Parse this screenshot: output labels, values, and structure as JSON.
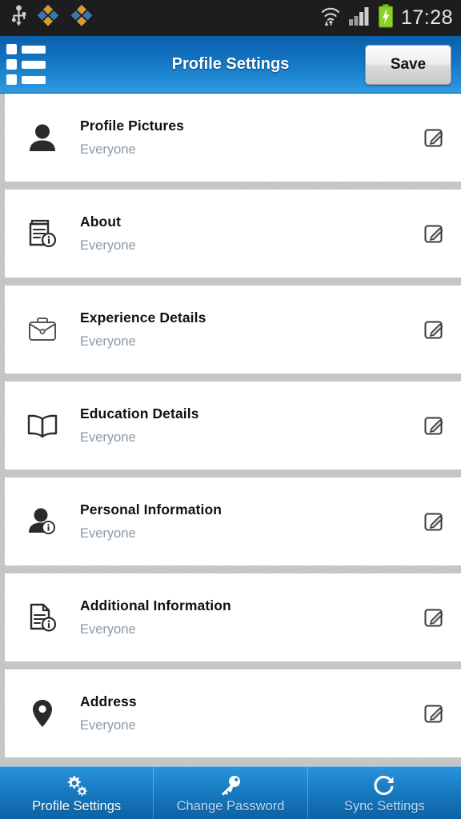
{
  "statusbar": {
    "time": "17:28",
    "icons": [
      "usb-icon",
      "app-badge-icon",
      "app-badge-icon"
    ],
    "right_icons": [
      "wifi-icon",
      "signal-icon",
      "battery-charging-icon"
    ]
  },
  "header": {
    "title": "Profile Settings",
    "menu_icon": "list-menu-icon",
    "save_label": "Save",
    "accent_color": "#1376c4"
  },
  "list": {
    "items": [
      {
        "icon": "person-icon",
        "title": "Profile Pictures",
        "privacy": "Everyone",
        "edit_icon": "edit-pencil-icon"
      },
      {
        "icon": "book-info-icon",
        "title": "About",
        "privacy": "Everyone",
        "edit_icon": "edit-pencil-icon"
      },
      {
        "icon": "briefcase-icon",
        "title": "Experience Details",
        "privacy": "Everyone",
        "edit_icon": "edit-pencil-icon"
      },
      {
        "icon": "open-book-icon",
        "title": "Education Details",
        "privacy": "Everyone",
        "edit_icon": "edit-pencil-icon"
      },
      {
        "icon": "person-info-icon",
        "title": "Personal Information",
        "privacy": "Everyone",
        "edit_icon": "edit-pencil-icon"
      },
      {
        "icon": "document-info-icon",
        "title": "Additional Information",
        "privacy": "Everyone",
        "edit_icon": "edit-pencil-icon"
      },
      {
        "icon": "map-pin-icon",
        "title": "Address",
        "privacy": "Everyone",
        "edit_icon": "edit-pencil-icon"
      }
    ]
  },
  "bottomnav": {
    "items": [
      {
        "label": "Profile Settings",
        "icon": "gears-icon",
        "active": true
      },
      {
        "label": "Change Password",
        "icon": "key-icon",
        "active": false
      },
      {
        "label": "Sync Settings",
        "icon": "refresh-icon",
        "active": false
      }
    ]
  }
}
